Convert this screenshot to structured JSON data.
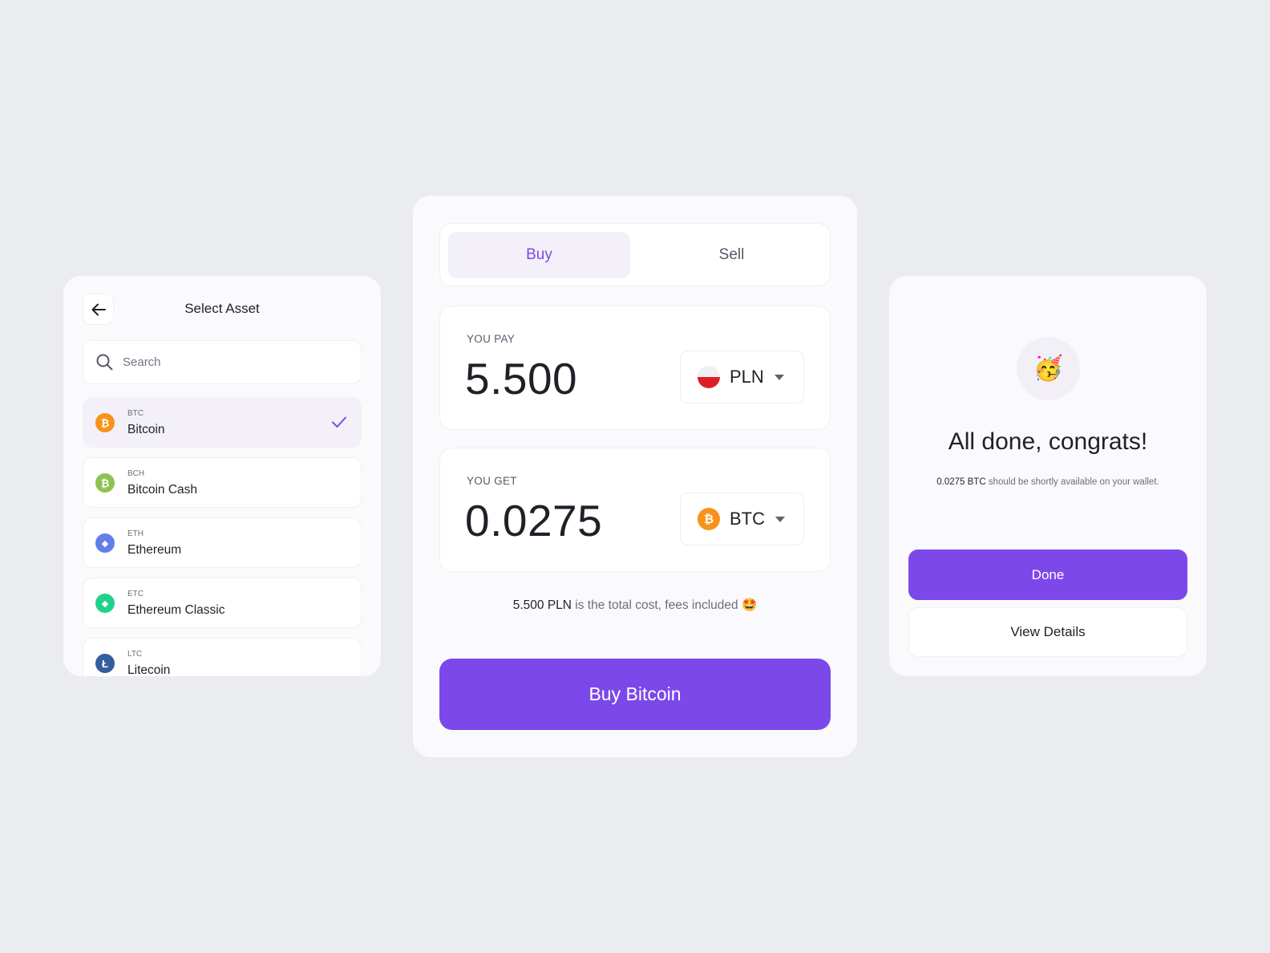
{
  "colors": {
    "accent": "#7d48ea",
    "background": "#ebecf0",
    "card": "#fafafc"
  },
  "select_asset": {
    "title": "Select Asset",
    "back_icon": "arrow-left-icon",
    "search": {
      "placeholder": "Search",
      "value": "",
      "icon": "search-icon"
    },
    "assets": [
      {
        "ticker": "BTC",
        "name": "Bitcoin",
        "color": "#f7931a",
        "glyph": "₿",
        "selected": true
      },
      {
        "ticker": "BCH",
        "name": "Bitcoin Cash",
        "color": "#8dc351",
        "glyph": "₿",
        "selected": false
      },
      {
        "ticker": "ETH",
        "name": "Ethereum",
        "color": "#627eea",
        "glyph": "◆",
        "selected": false
      },
      {
        "ticker": "ETC",
        "name": "Ethereum Classic",
        "color": "#1fd28a",
        "glyph": "◆",
        "selected": false
      },
      {
        "ticker": "LTC",
        "name": "Litecoin",
        "color": "#345d9d",
        "glyph": "Ł",
        "selected": false
      }
    ]
  },
  "trade": {
    "tabs": [
      {
        "label": "Buy",
        "active": true
      },
      {
        "label": "Sell",
        "active": false
      }
    ],
    "pay": {
      "label": "YOU PAY",
      "value": "5.500",
      "currency": "PLN"
    },
    "get": {
      "label": "YOU GET",
      "value": "0.0275",
      "currency": "BTC"
    },
    "cost_note": {
      "amount": "5.500 PLN",
      "text": " is the total cost, fees included ",
      "emoji": "🤩"
    },
    "cta": "Buy Bitcoin"
  },
  "success": {
    "emoji": "🥳",
    "title": "All done, congrats!",
    "amount": "0.0275 BTC",
    "subtitle": " should be shortly available on your wallet.",
    "done_label": "Done",
    "details_label": "View Details"
  }
}
